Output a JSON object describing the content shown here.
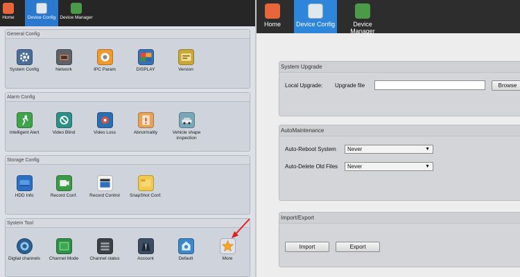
{
  "left_nav": {
    "home_label": "Home",
    "device_config_label": "Device Config",
    "device_manager_label": "Device Manager"
  },
  "general_config": {
    "title": "General Config",
    "items": [
      {
        "label": "System Config",
        "icon": "gear-icon"
      },
      {
        "label": "Network",
        "icon": "network-icon"
      },
      {
        "label": "IPC Param",
        "icon": "camera-icon"
      },
      {
        "label": "DISPLAY",
        "icon": "display-icon"
      },
      {
        "label": "Version",
        "icon": "version-icon"
      }
    ]
  },
  "alarm_config": {
    "title": "Alarm Config",
    "items": [
      {
        "label": "Intelligent Alert",
        "icon": "running-man-icon"
      },
      {
        "label": "Video Blind",
        "icon": "video-blind-icon"
      },
      {
        "label": "Video Loss",
        "icon": "video-loss-icon"
      },
      {
        "label": "Abnormality",
        "icon": "abnormality-icon"
      },
      {
        "label": "Vehicle shape inspection",
        "icon": "vehicle-icon"
      }
    ]
  },
  "storage_config": {
    "title": "Storage Config",
    "items": [
      {
        "label": "HDD Info",
        "icon": "hdd-icon"
      },
      {
        "label": "Record Conf.",
        "icon": "record-conf-icon"
      },
      {
        "label": "Record Control",
        "icon": "record-control-icon"
      },
      {
        "label": "SnapShot Conf.",
        "icon": "snapshot-icon"
      }
    ]
  },
  "system_tool": {
    "title": "System Tool",
    "items": [
      {
        "label": "Digtial channels",
        "icon": "digital-channel-icon"
      },
      {
        "label": "Channel Mode",
        "icon": "channel-mode-icon"
      },
      {
        "label": "Channel status",
        "icon": "channel-status-icon"
      },
      {
        "label": "Account",
        "icon": "account-icon"
      },
      {
        "label": "Default",
        "icon": "default-icon"
      },
      {
        "label": "More",
        "icon": "star-icon"
      }
    ]
  },
  "right_nav": {
    "home_label": "Home",
    "device_config_label": "Device Config",
    "device_manager_label": "Device Manager"
  },
  "system_upgrade": {
    "title": "System Upgrade",
    "local_upgrade_label": "Local Upgrade:",
    "upgrade_file_label": "Upgrade file",
    "file_value": "",
    "browse_label": "Browse"
  },
  "auto_maintenance": {
    "title": "AutoMaintenance",
    "auto_reboot_label": "Auto-Reboot System",
    "auto_reboot_value": "Never",
    "auto_delete_label": "Auto-Delete Old Files",
    "auto_delete_value": "Never"
  },
  "import_export": {
    "title": "Import/Export",
    "import_label": "Import",
    "export_label": "Export"
  },
  "colors": {
    "active_tab": "#2a79cf",
    "pointer": "#e01e1e",
    "star": "#f6a623"
  }
}
